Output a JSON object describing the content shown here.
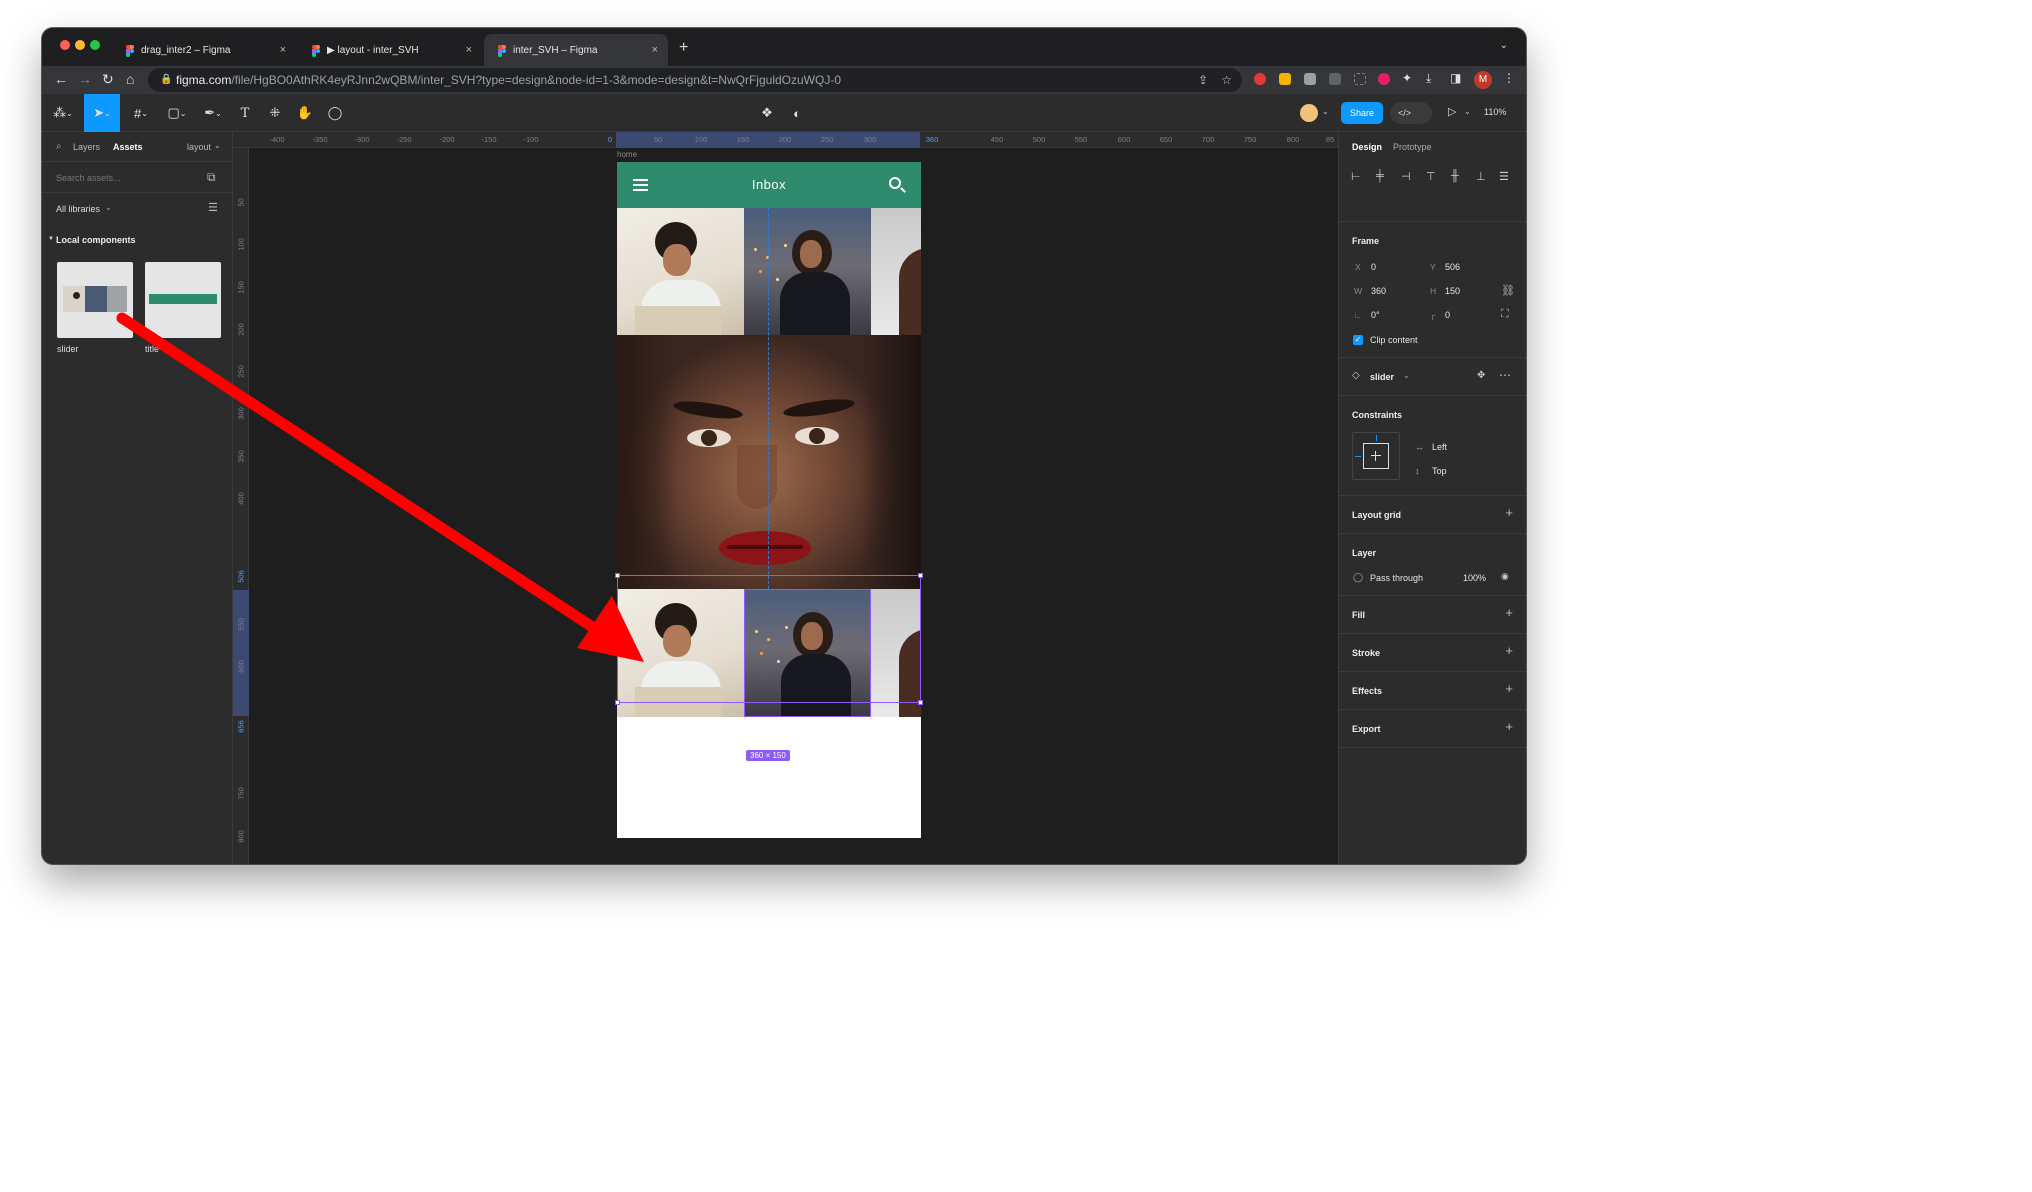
{
  "browser": {
    "tabs": [
      {
        "title": "drag_inter2 – Figma",
        "close": "×"
      },
      {
        "title": "▶ layout - inter_SVH",
        "close": "×"
      },
      {
        "title": "inter_SVH – Figma",
        "close": "×"
      }
    ],
    "new_tab": "+",
    "tab_menu": "⌄",
    "url_host": "figma.com",
    "url_path": "/file/HgBO0AthRK4eyRJnn2wQBM/inter_SVH?type=design&node-id=1-3&mode=design&t=NwQrFjguldOzuWQJ-0",
    "profile_initial": "M"
  },
  "toolbar": {
    "share_label": "Share",
    "zoom_label": "110%",
    "code_label": "</>",
    "text_tool": "T"
  },
  "left_panel": {
    "tab_layers": "Layers",
    "tab_assets": "Assets",
    "page_select": "layout",
    "search_placeholder": "Search assets...",
    "libraries_label": "All libraries",
    "section_title": "Local components",
    "components": [
      {
        "name": "slider"
      },
      {
        "name": "title"
      }
    ]
  },
  "rulers": {
    "top_ticks": [
      "-400",
      "-350",
      "-300",
      "-250",
      "-200",
      "-150",
      "-100",
      "0",
      "50",
      "100",
      "150",
      "200",
      "250",
      "300",
      "360",
      "450",
      "500",
      "550",
      "600",
      "650",
      "700",
      "750",
      "800",
      "85"
    ],
    "left_ticks": [
      "50",
      "100",
      "150",
      "200",
      "250",
      "300",
      "350",
      "400",
      "506",
      "550",
      "600",
      "656",
      "750",
      "800"
    ]
  },
  "canvas": {
    "frame_label": "home",
    "appbar_title": "Inbox",
    "selection_size": "360 × 150",
    "help_label": "?"
  },
  "right_panel": {
    "tab_design": "Design",
    "tab_prototype": "Prototype",
    "frame_title": "Frame",
    "x_label": "X",
    "x_value": "0",
    "y_label": "Y",
    "y_value": "506",
    "w_label": "W",
    "w_value": "360",
    "h_label": "H",
    "h_value": "150",
    "rotation_value": "0°",
    "radius_value": "0",
    "clip_content_label": "Clip content",
    "clip_content_checked": true,
    "component_name": "slider",
    "constraints_title": "Constraints",
    "constraint_h": "Left",
    "constraint_v": "Top",
    "layout_grid_title": "Layout grid",
    "layer_title": "Layer",
    "blend_mode": "Pass through",
    "opacity": "100%",
    "fill_title": "Fill",
    "stroke_title": "Stroke",
    "effects_title": "Effects",
    "export_title": "Export"
  },
  "colors": {
    "figma_blue": "#0d99ff",
    "selection_purple": "#8c5cf5",
    "appbar_green": "#2e8b6e",
    "annotation_red": "#ff0000"
  }
}
